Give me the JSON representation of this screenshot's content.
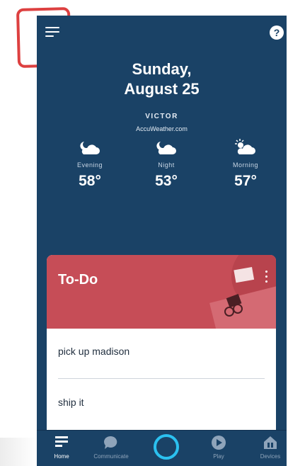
{
  "header": {
    "menu_icon": "hamburger-menu-icon",
    "help_icon": "help-icon",
    "help_symbol": "?"
  },
  "date": {
    "weekday": "Sunday,",
    "month_day": "August 25"
  },
  "weather": {
    "location": "VICTOR",
    "source": "AccuWeather.com",
    "forecast": [
      {
        "period": "Evening",
        "temp": "58°",
        "icon": "cloudy-moon-icon"
      },
      {
        "period": "Night",
        "temp": "53°",
        "icon": "cloudy-moon-icon"
      },
      {
        "period": "Morning",
        "temp": "57°",
        "icon": "partly-sunny-icon"
      }
    ]
  },
  "todo": {
    "title": "To-Do",
    "items": [
      "pick up madison",
      "ship it"
    ]
  },
  "nav": {
    "items": [
      {
        "label": "Home",
        "icon": "home-icon",
        "active": true
      },
      {
        "label": "Communicate",
        "icon": "chat-bubble-icon",
        "active": false
      },
      {
        "label": "",
        "icon": "alexa-icon",
        "active": false
      },
      {
        "label": "Play",
        "icon": "play-icon",
        "active": false
      },
      {
        "label": "Devices",
        "icon": "devices-icon",
        "active": false
      }
    ]
  },
  "colors": {
    "background": "#1a4266",
    "todo_header": "#c64d57",
    "alexa_ring": "#2bc1f0",
    "highlight": "#d92b2b"
  }
}
